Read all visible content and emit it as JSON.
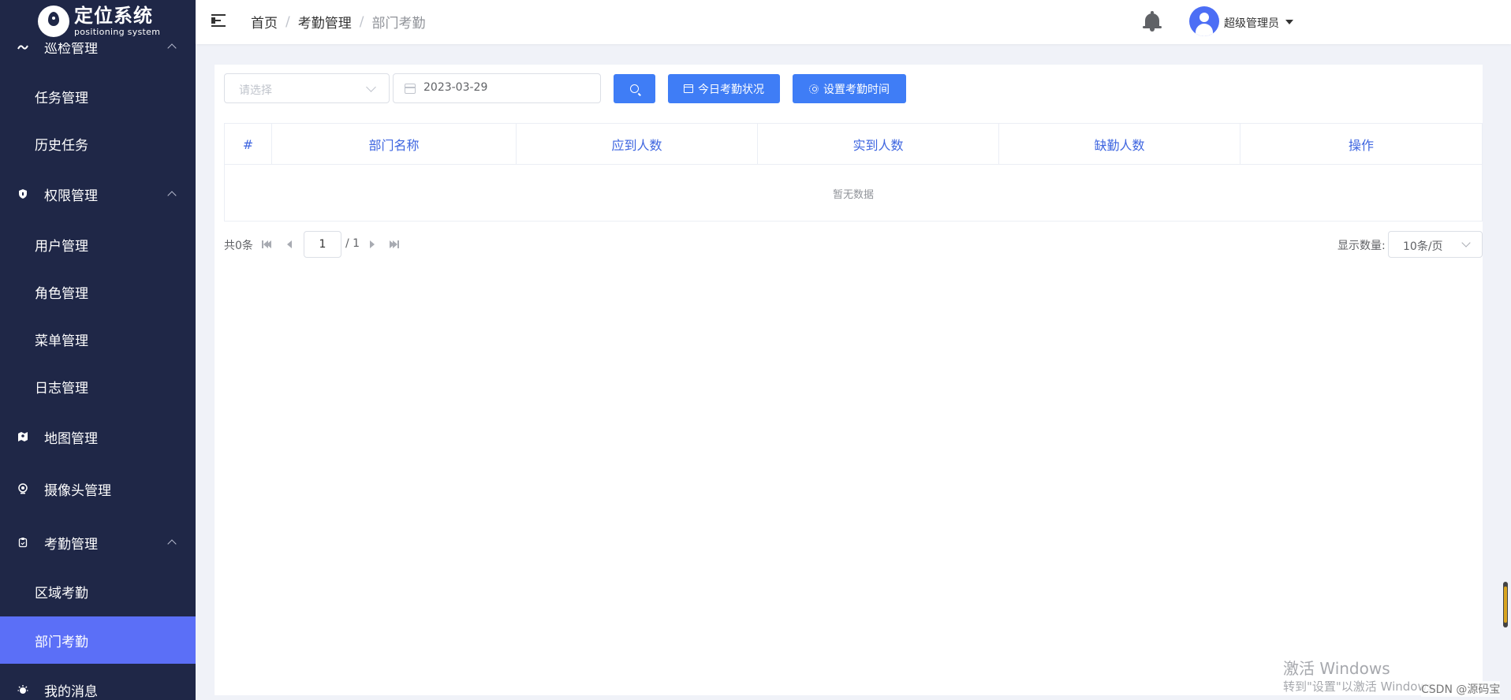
{
  "app": {
    "logo_title": "定位系统",
    "logo_subtitle": "positioning system"
  },
  "sidebar": {
    "items": [
      {
        "label": "巡检管理",
        "type": "parent",
        "icon": "patrol-icon",
        "expanded": true
      },
      {
        "label": "任务管理",
        "type": "child"
      },
      {
        "label": "历史任务",
        "type": "child"
      },
      {
        "label": "权限管理",
        "type": "parent",
        "icon": "shield-icon",
        "expanded": true
      },
      {
        "label": "用户管理",
        "type": "child"
      },
      {
        "label": "角色管理",
        "type": "child"
      },
      {
        "label": "菜单管理",
        "type": "child"
      },
      {
        "label": "日志管理",
        "type": "child"
      },
      {
        "label": "地图管理",
        "type": "parent",
        "icon": "map-icon"
      },
      {
        "label": "摄像头管理",
        "type": "parent",
        "icon": "camera-icon"
      },
      {
        "label": "考勤管理",
        "type": "parent",
        "icon": "clipboard-icon",
        "expanded": true
      },
      {
        "label": "区域考勤",
        "type": "child"
      },
      {
        "label": "部门考勤",
        "type": "child",
        "active": true
      },
      {
        "label": "我的消息",
        "type": "parent",
        "icon": "message-icon"
      }
    ]
  },
  "header": {
    "breadcrumb": [
      "首页",
      "考勤管理",
      "部门考勤"
    ],
    "breadcrumb_sep": "/",
    "username": "超级管理员"
  },
  "toolbar": {
    "select_placeholder": "请选择",
    "date_value": "2023-03-29",
    "today_label": "今日考勤状况",
    "set_time_label": "设置考勤时间"
  },
  "table": {
    "columns": [
      "#",
      "部门名称",
      "应到人数",
      "实到人数",
      "缺勤人数",
      "操作"
    ],
    "rows": [],
    "empty_text": "暂无数据"
  },
  "pagination": {
    "total_text": "共0条",
    "current_page": "1",
    "page_of": "/ 1",
    "size_label": "显示数量:",
    "size_value": "10条/页"
  },
  "watermark": {
    "title": "激活 Windows",
    "subtitle": "转到\"设置\"以激活 Windows。",
    "credit": "CSDN @源码宝"
  },
  "colors": {
    "sidebar_bg": "#1f2747",
    "active_bg": "#5b6ff7",
    "primary": "#3f7df6",
    "header_text": "#3f66e0"
  }
}
